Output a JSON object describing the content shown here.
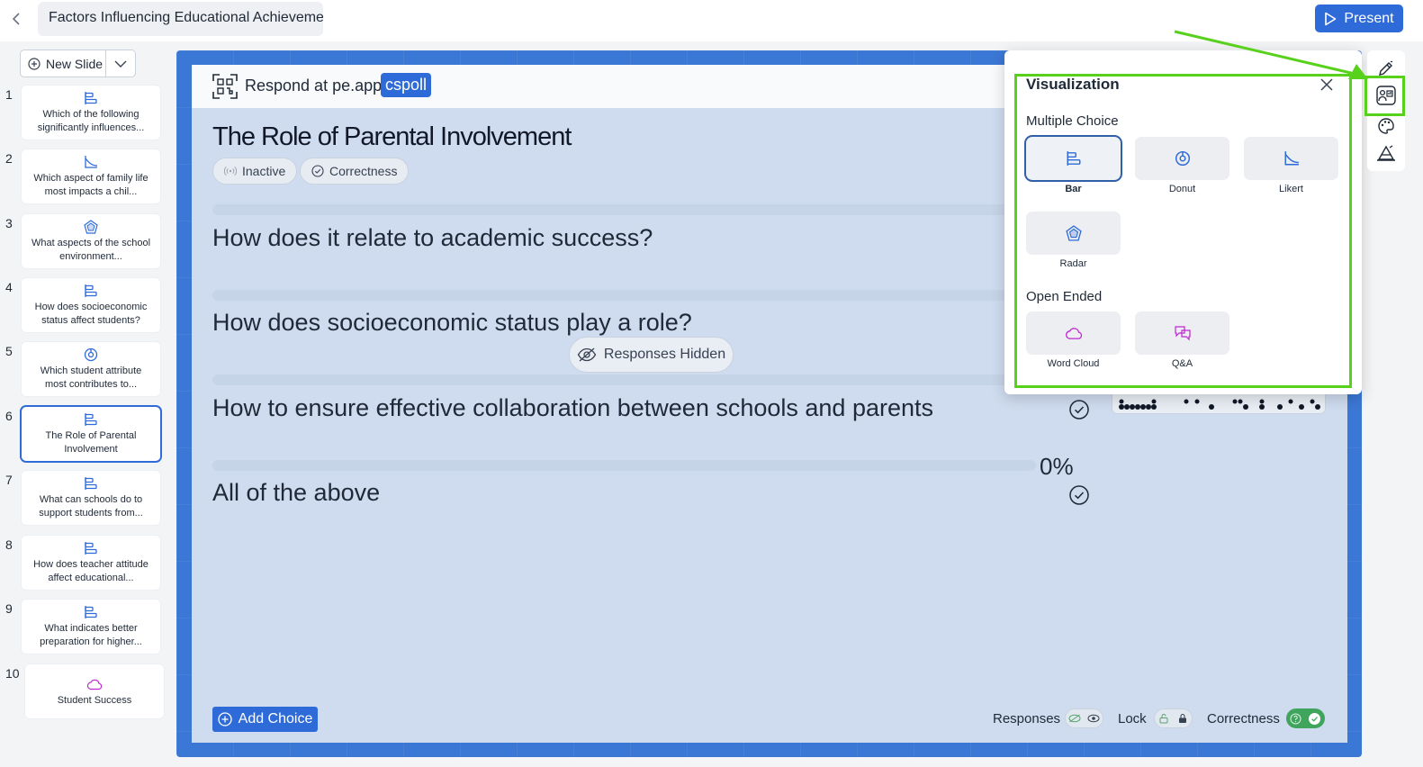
{
  "app": {
    "presentation_title": "Factors Influencing Educational Achievemen",
    "present_label": "Present"
  },
  "sidebar": {
    "new_slide_label": "New Slide",
    "slides": [
      {
        "num": "1",
        "title": "Which of the following significantly influences...",
        "icon": "bar-chart-icon"
      },
      {
        "num": "2",
        "title": "Which aspect of family life most impacts a chil...",
        "icon": "likert-icon"
      },
      {
        "num": "3",
        "title": "What aspects of the school environment...",
        "icon": "radar-icon"
      },
      {
        "num": "4",
        "title": "How does socioeconomic status affect students?",
        "icon": "bar-chart-icon"
      },
      {
        "num": "5",
        "title": "Which student attribute most contributes to...",
        "icon": "donut-icon"
      },
      {
        "num": "6",
        "title": "The Role of Parental Involvement",
        "icon": "bar-chart-icon"
      },
      {
        "num": "7",
        "title": "What can schools do to support students from...",
        "icon": "bar-chart-icon"
      },
      {
        "num": "8",
        "title": "How does teacher attitude affect educational...",
        "icon": "bar-chart-icon"
      },
      {
        "num": "9",
        "title": "What indicates better preparation for higher...",
        "icon": "bar-chart-icon"
      },
      {
        "num": "10",
        "title": "Student Success",
        "icon": "word-cloud-icon"
      }
    ]
  },
  "slide": {
    "respond_prefix": "Respond at pe.app/",
    "poll_code": "cspoll",
    "title": "The Role of Parental Involvement",
    "status_chip": "Inactive",
    "correctness_chip": "Correctness",
    "choices": [
      {
        "text": "How does it relate to academic success?"
      },
      {
        "text": "How does socioeconomic status play a role?"
      },
      {
        "text": "How to ensure effective collaboration between schools and parents"
      },
      {
        "text": "All of the above"
      }
    ],
    "percent_label": "0%",
    "responses_hidden_label": "Responses Hidden",
    "add_choice_label": "Add Choice",
    "toggles": {
      "responses_label": "Responses",
      "lock_label": "Lock",
      "correctness_label": "Correctness"
    }
  },
  "visualization_panel": {
    "title": "Visualization",
    "multiple_choice_heading": "Multiple Choice",
    "open_ended_heading": "Open Ended",
    "options": {
      "bar": "Bar",
      "donut": "Donut",
      "likert": "Likert",
      "radar": "Radar",
      "word_cloud": "Word Cloud",
      "qa": "Q&A"
    },
    "selected": "Bar"
  },
  "colors": {
    "accent": "#2f6bd8",
    "stage_background": "#3b77d4",
    "annotation_highlight": "#58d11c",
    "word_cloud_icon": "#c026d3"
  }
}
